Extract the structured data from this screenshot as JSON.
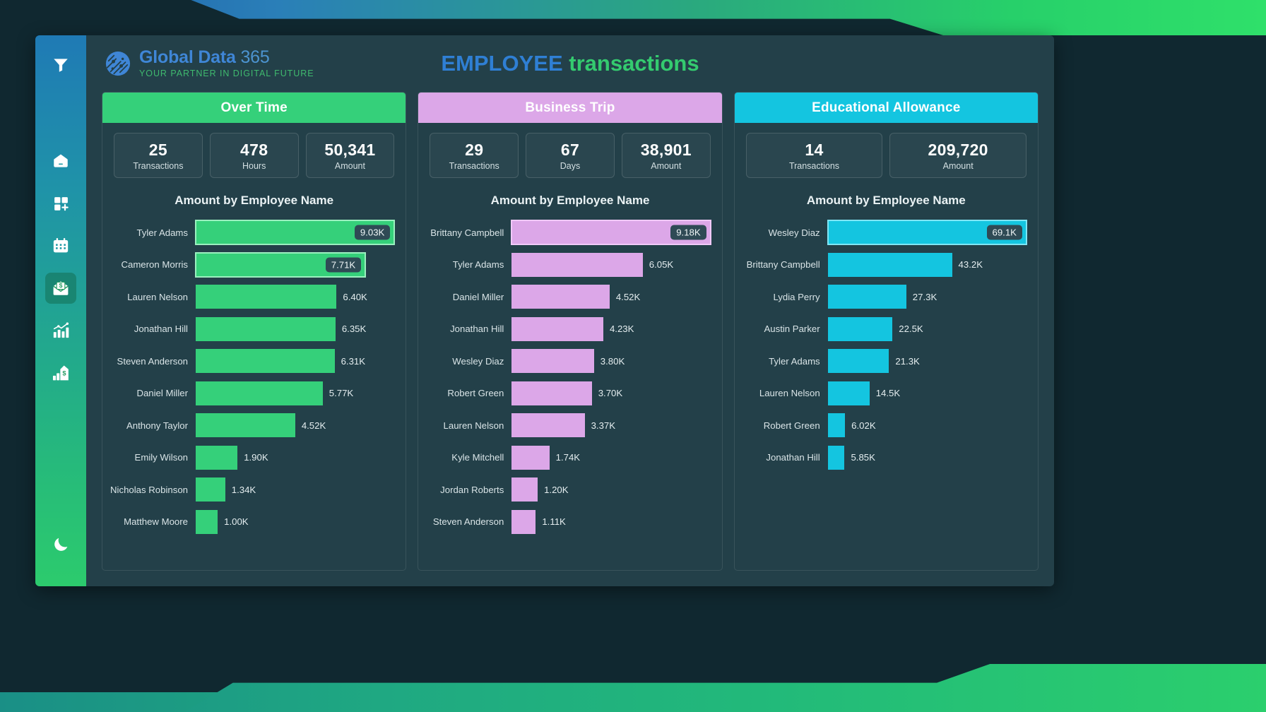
{
  "brand": {
    "logo_icon": "globe-network-icon",
    "name_primary": "Global Data",
    "name_suffix": "365",
    "tagline": "YOUR PARTNER IN DIGITAL FUTURE",
    "primary_color": "#3f86d6",
    "accent_color": "#3fb96e"
  },
  "header": {
    "title_part1": "EMPLOYEE",
    "title_part2": "transactions",
    "title_color1": "#2f7fd4",
    "title_color2": "#34cb6f"
  },
  "sidebar": {
    "items": [
      {
        "icon": "filter-funnel-icon",
        "active": false
      },
      {
        "icon": "home-icon",
        "active": false
      },
      {
        "icon": "grid-add-icon",
        "active": false
      },
      {
        "icon": "calendar-icon",
        "active": false
      },
      {
        "icon": "money-envelope-icon",
        "active": true
      },
      {
        "icon": "bar-chart-trend-icon",
        "active": false
      },
      {
        "icon": "building-dollar-icon",
        "active": false
      }
    ],
    "bottom_item": {
      "icon": "moon-icon",
      "active": false
    }
  },
  "panels": [
    {
      "id": "over-time",
      "title": "Over Time",
      "header_color": "#35d07a",
      "bar_color": "#35d07a",
      "kpis": [
        {
          "value": "25",
          "label": "Transactions"
        },
        {
          "value": "478",
          "label": "Hours"
        },
        {
          "value": "50,341",
          "label": "Amount"
        }
      ],
      "chart_title": "Amount by Employee Name"
    },
    {
      "id": "business-trip",
      "title": "Business Trip",
      "header_color": "#dca7e8",
      "bar_color": "#dca7e8",
      "kpis": [
        {
          "value": "29",
          "label": "Transactions"
        },
        {
          "value": "67",
          "label": "Days"
        },
        {
          "value": "38,901",
          "label": "Amount"
        }
      ],
      "chart_title": "Amount by Employee Name"
    },
    {
      "id": "educational-allowance",
      "title": "Educational Allowance",
      "header_color": "#14c5e0",
      "bar_color": "#14c5e0",
      "kpis": [
        {
          "value": "14",
          "label": "Transactions"
        },
        {
          "value": "209,720",
          "label": "Amount"
        }
      ],
      "chart_title": "Amount by Employee Name"
    }
  ],
  "chart_data": [
    {
      "type": "bar",
      "orientation": "horizontal",
      "title": "Amount by Employee Name",
      "panel": "Over Time",
      "xlabel": "Amount",
      "ylabel": "Employee Name",
      "series_color": "#35d07a",
      "categories": [
        "Tyler Adams",
        "Cameron Morris",
        "Lauren Nelson",
        "Jonathan Hill",
        "Steven Anderson",
        "Daniel Miller",
        "Anthony Taylor",
        "Emily Wilson",
        "Nicholas Robinson",
        "Matthew Moore"
      ],
      "values": [
        9030,
        7710,
        6400,
        6350,
        6310,
        5770,
        4520,
        1900,
        1340,
        1000
      ],
      "labels": [
        "9.03K",
        "7.71K",
        "6.40K",
        "6.35K",
        "6.31K",
        "5.77K",
        "4.52K",
        "1.90K",
        "1.34K",
        "1.00K"
      ],
      "label_inside": [
        true,
        true,
        false,
        false,
        false,
        false,
        false,
        false,
        false,
        false
      ],
      "highlighted": [
        "Tyler Adams",
        "Cameron Morris"
      ],
      "xlim": [
        0,
        9030
      ],
      "grid": false,
      "legend": "none"
    },
    {
      "type": "bar",
      "orientation": "horizontal",
      "title": "Amount by Employee Name",
      "panel": "Business Trip",
      "xlabel": "Amount",
      "ylabel": "Employee Name",
      "series_color": "#dca7e8",
      "categories": [
        "Brittany Campbell",
        "Tyler Adams",
        "Daniel Miller",
        "Jonathan Hill",
        "Wesley Diaz",
        "Robert Green",
        "Lauren Nelson",
        "Kyle Mitchell",
        "Jordan Roberts",
        "Steven Anderson"
      ],
      "values": [
        9180,
        6050,
        4520,
        4230,
        3800,
        3700,
        3370,
        1740,
        1200,
        1110
      ],
      "labels": [
        "9.18K",
        "6.05K",
        "4.52K",
        "4.23K",
        "3.80K",
        "3.70K",
        "3.37K",
        "1.74K",
        "1.20K",
        "1.11K"
      ],
      "label_inside": [
        true,
        false,
        false,
        false,
        false,
        false,
        false,
        false,
        false,
        false
      ],
      "highlighted": [
        "Brittany Campbell"
      ],
      "xlim": [
        0,
        9180
      ],
      "grid": false,
      "legend": "none"
    },
    {
      "type": "bar",
      "orientation": "horizontal",
      "title": "Amount by Employee Name",
      "panel": "Educational Allowance",
      "xlabel": "Amount",
      "ylabel": "Employee Name",
      "series_color": "#14c5e0",
      "categories": [
        "Wesley Diaz",
        "Brittany Campbell",
        "Lydia Perry",
        "Austin Parker",
        "Tyler Adams",
        "Lauren Nelson",
        "Robert Green",
        "Jonathan Hill"
      ],
      "values": [
        69100,
        43200,
        27300,
        22500,
        21300,
        14500,
        6020,
        5850
      ],
      "labels": [
        "69.1K",
        "43.2K",
        "27.3K",
        "22.5K",
        "21.3K",
        "14.5K",
        "6.02K",
        "5.85K"
      ],
      "label_inside": [
        true,
        false,
        false,
        false,
        false,
        false,
        false,
        false
      ],
      "highlighted": [
        "Wesley Diaz"
      ],
      "xlim": [
        0,
        69100
      ],
      "grid": false,
      "legend": "none"
    }
  ]
}
